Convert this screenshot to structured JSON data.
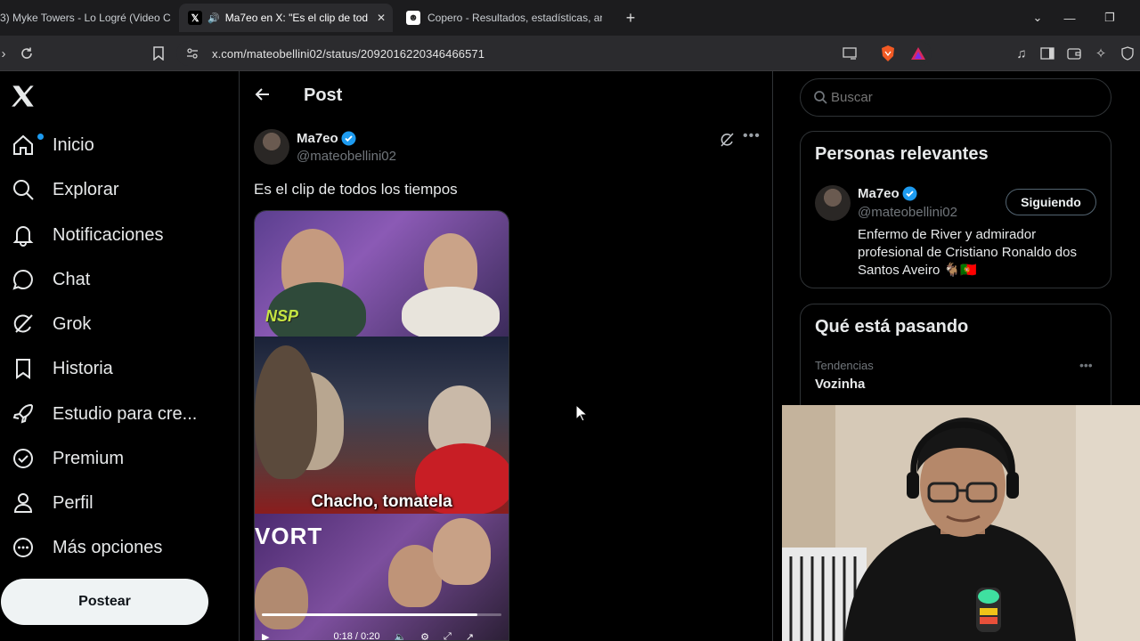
{
  "browser": {
    "tabs": [
      {
        "title": "3) Myke Towers - Lo Logré (Video C",
        "favicon": "youtube-icon",
        "active": false
      },
      {
        "title": "Ma7eo en X: \"Es el clip de tod",
        "favicon": "x-icon",
        "active": true,
        "audio": true
      },
      {
        "title": "Copero - Resultados, estadísticas, an",
        "favicon": "copero-icon",
        "active": false
      }
    ],
    "url": "x.com/mateobellini02/status/2092016220346466571"
  },
  "nav": {
    "items": [
      {
        "label": "Inicio",
        "icon": "home-icon"
      },
      {
        "label": "Explorar",
        "icon": "search-icon"
      },
      {
        "label": "Notificaciones",
        "icon": "bell-icon"
      },
      {
        "label": "Chat",
        "icon": "chat-icon"
      },
      {
        "label": "Grok",
        "icon": "grok-icon"
      },
      {
        "label": "Historia",
        "icon": "bookmark-icon"
      },
      {
        "label": "Estudio para cre...",
        "icon": "rocket-icon"
      },
      {
        "label": "Premium",
        "icon": "verified-badge-icon"
      },
      {
        "label": "Perfil",
        "icon": "person-icon"
      },
      {
        "label": "Más opciones",
        "icon": "more-circle-icon"
      }
    ],
    "post_button": "Postear"
  },
  "main": {
    "heading": "Post",
    "author": {
      "name": "Ma7eo",
      "handle": "@mateobellini02"
    },
    "text": "Es el clip de todos los tiempos",
    "video": {
      "overlay_nsp": "NSP",
      "caption": "Chacho, tomatela",
      "overlay_vort": "VORT",
      "time": "0:18 / 0:20",
      "progress": 0.9
    }
  },
  "sidebar": {
    "search_placeholder": "Buscar",
    "relevant": {
      "title": "Personas relevantes",
      "name": "Ma7eo",
      "handle": "@mateobellini02",
      "button": "Siguiendo",
      "bio": "Enfermo de River y admirador profesional de Cristiano Ronaldo dos Santos Aveiro 🐐🇵🇹"
    },
    "trending": {
      "title": "Qué está pasando",
      "category": "Tendencias",
      "name": "Vozinha"
    }
  },
  "colors": {
    "accent": "#1d9bf0",
    "background": "#000000",
    "text": "#e7e9ea",
    "muted": "#71767b"
  }
}
